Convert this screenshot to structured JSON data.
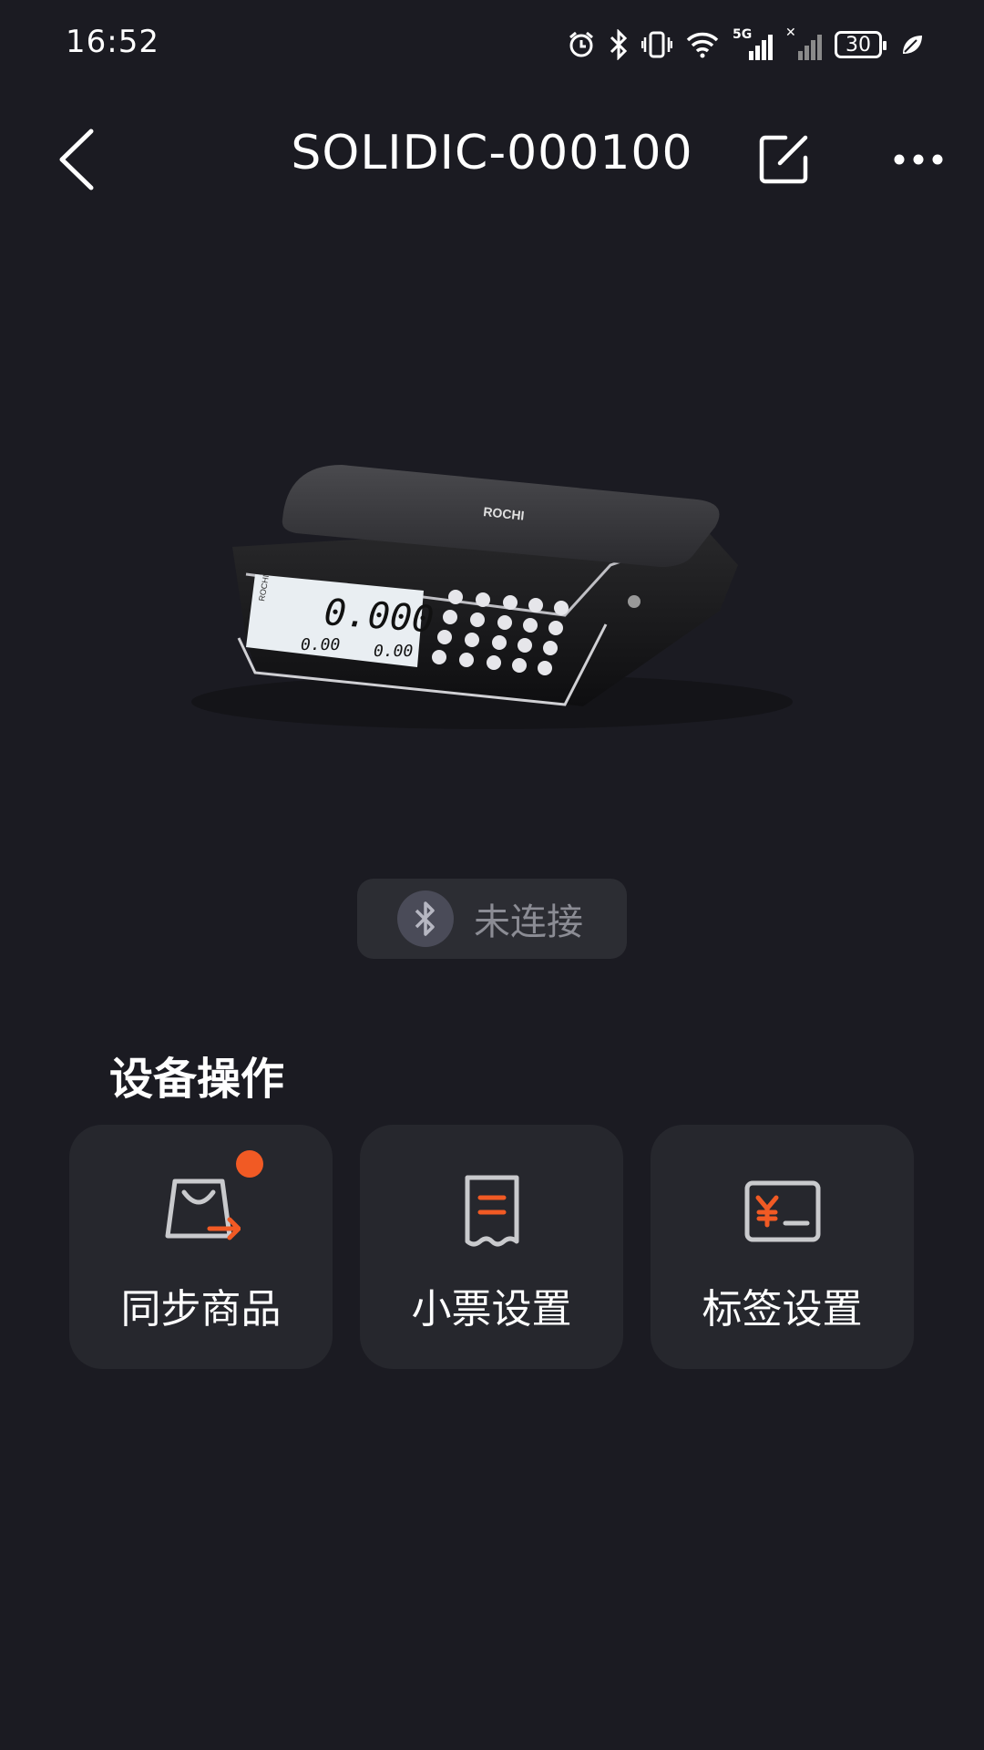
{
  "status_bar": {
    "time": "16:52",
    "network_label": "5G",
    "battery": "30",
    "icons": [
      "alarm-icon",
      "bluetooth-icon",
      "vibrate-icon",
      "wifi-icon",
      "signal-icon",
      "no-signal-icon",
      "battery-icon",
      "leaf-icon"
    ]
  },
  "header": {
    "title": "SOLIDIC-000100",
    "icons": [
      "back-icon",
      "edit-icon",
      "more-icon"
    ]
  },
  "device": {
    "brand": "ROCHI",
    "display_main": "0.000",
    "display_left": "0.00",
    "display_right": "0.00"
  },
  "connection": {
    "status": "未连接",
    "icon": "bluetooth-icon"
  },
  "operations": {
    "section_title": "设备操作",
    "items": [
      {
        "label": "同步商品",
        "icon": "shopping-bag-sync-icon",
        "badge": true
      },
      {
        "label": "小票设置",
        "icon": "receipt-icon",
        "badge": false
      },
      {
        "label": "标签设置",
        "icon": "price-label-icon",
        "badge": false
      }
    ]
  },
  "colors": {
    "background": "#1b1b22",
    "card": "#26272d",
    "accent": "#f15a24",
    "muted_text": "#8b8c94"
  }
}
